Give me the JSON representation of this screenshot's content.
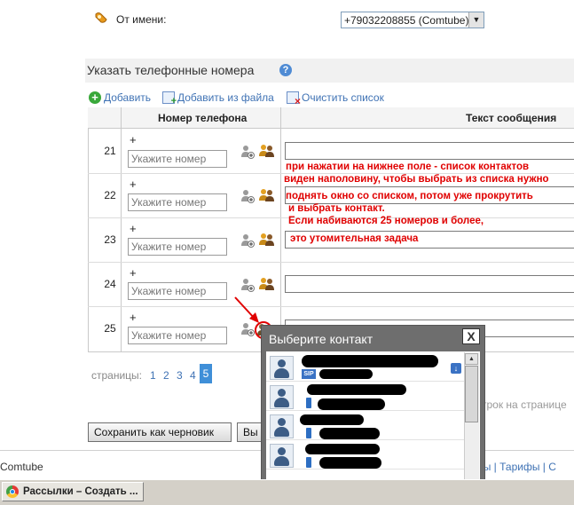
{
  "from": {
    "label": "От имени:",
    "selected": "+79032208855 (Comtube)"
  },
  "section": {
    "title": "Указать телефонные номера",
    "help": "?"
  },
  "toolbar": {
    "add": "Добавить",
    "add_from_file": "Добавить из файла",
    "clear_list": "Очистить список"
  },
  "table": {
    "col_phone": "Номер телефона",
    "col_message": "Текст сообщения",
    "rows": [
      {
        "num": "21",
        "plus": "+",
        "placeholder": "Укажите номер"
      },
      {
        "num": "22",
        "plus": "+",
        "placeholder": "Укажите номер"
      },
      {
        "num": "23",
        "plus": "+",
        "placeholder": "Укажите номер"
      },
      {
        "num": "24",
        "plus": "+",
        "placeholder": "Укажите номер"
      },
      {
        "num": "25",
        "plus": "+",
        "placeholder": "Укажите номер"
      }
    ]
  },
  "annotation": {
    "line1": "при нажатии на нижнее поле - список контактов",
    "line2": "виден наполовину, чтобы выбрать из списка нужно",
    "line3": "поднять окно со списком, потом уже прокрутить",
    "line4": "и выбрать контакт.",
    "line5": "Если набиваются 25 номеров и более,",
    "line6": "это утомительная задача"
  },
  "pagination": {
    "label": "страницы:",
    "pages": [
      "1",
      "2",
      "3",
      "4"
    ],
    "current": "5",
    "per_page_fragment": "строк на странице"
  },
  "buttons": {
    "save_draft": "Сохранить как черновик",
    "next_fragment": "Вы"
  },
  "footer": {
    "brand": "Comtube",
    "links_fragment": "исы | Тарифы | С"
  },
  "popup": {
    "title": "Выберите контакт",
    "close": "X",
    "sip": "SIP"
  },
  "taskbar": {
    "window_title": "Рассылки – Создать ..."
  },
  "colors": {
    "accent": "#3f72b4",
    "annotation": "#e00000",
    "popup_bg": "#6e6e6e"
  }
}
